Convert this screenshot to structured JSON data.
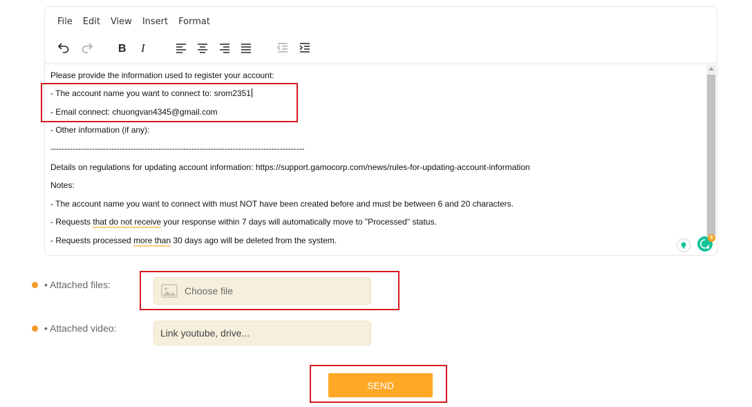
{
  "editor": {
    "menu": [
      "File",
      "Edit",
      "View",
      "Insert",
      "Format"
    ],
    "toolbar_icons": [
      "undo-icon",
      "redo-icon",
      "bold-icon",
      "italic-icon",
      "align-left-icon",
      "align-center-icon",
      "align-right-icon",
      "align-justify-icon",
      "outdent-icon",
      "indent-icon"
    ],
    "lines": {
      "l1": "Please provide the information used to register your account:",
      "l2": "- The account name you want to connect to: srom2351",
      "l3": "- Email connect: chuongvan4345@gmail.com",
      "l4": "- Other information (if any):",
      "l5": "--------------------------------------------------------------------------------------------",
      "l6": "Details on regulations for updating account information: https://support.gamocorp.com/news/rules-for-updating-account-information",
      "l7": "Notes:",
      "l8": "- The account name you want to connect with must NOT have been created before and must be between 6 and 20 characters.",
      "l9a": "- Requests ",
      "l9b": "that do not receive",
      "l9c": " your response within 7 days will automatically move to \"Processed\" status.",
      "l10a": "- Requests processed ",
      "l10b": "more than",
      "l10c": " 30 days ago will be deleted from the system."
    },
    "grammarly_badge": "5"
  },
  "form": {
    "attached_files_label": "• Attached files:",
    "choose_file_placeholder": "Choose file",
    "attached_video_label": "• Attached video:",
    "video_placeholder": "Link youtube, drive...",
    "send_label": "SEND"
  },
  "colors": {
    "accent": "#ffa927",
    "highlight": "#d7191e",
    "input_bg": "#f5efdb",
    "dot": "#f39a27"
  }
}
